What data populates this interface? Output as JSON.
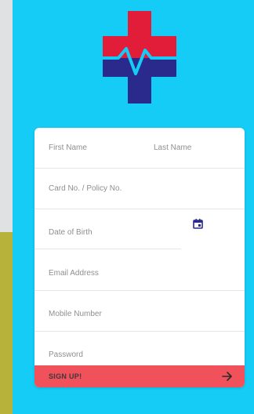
{
  "logo": {
    "icon": "medical-cross-heartbeat-icon",
    "colors": {
      "cross": "#e21d3a",
      "base": "#2a2a8c",
      "pulse": "#14ccf6"
    }
  },
  "form": {
    "first_name_placeholder": "First Name",
    "last_name_placeholder": "Last Name",
    "card_placeholder": "Card No. / Policy No.",
    "dob_placeholder": "Date of Birth",
    "email_placeholder": "Email Address",
    "mobile_placeholder": "Mobile Number",
    "password_placeholder": "Password"
  },
  "signup": {
    "label": "SIGN UP!",
    "icon": "arrow-right-icon"
  },
  "colors": {
    "panel": "#14ccf6",
    "accent": "#f0515b",
    "strip": "#b7b23a"
  }
}
